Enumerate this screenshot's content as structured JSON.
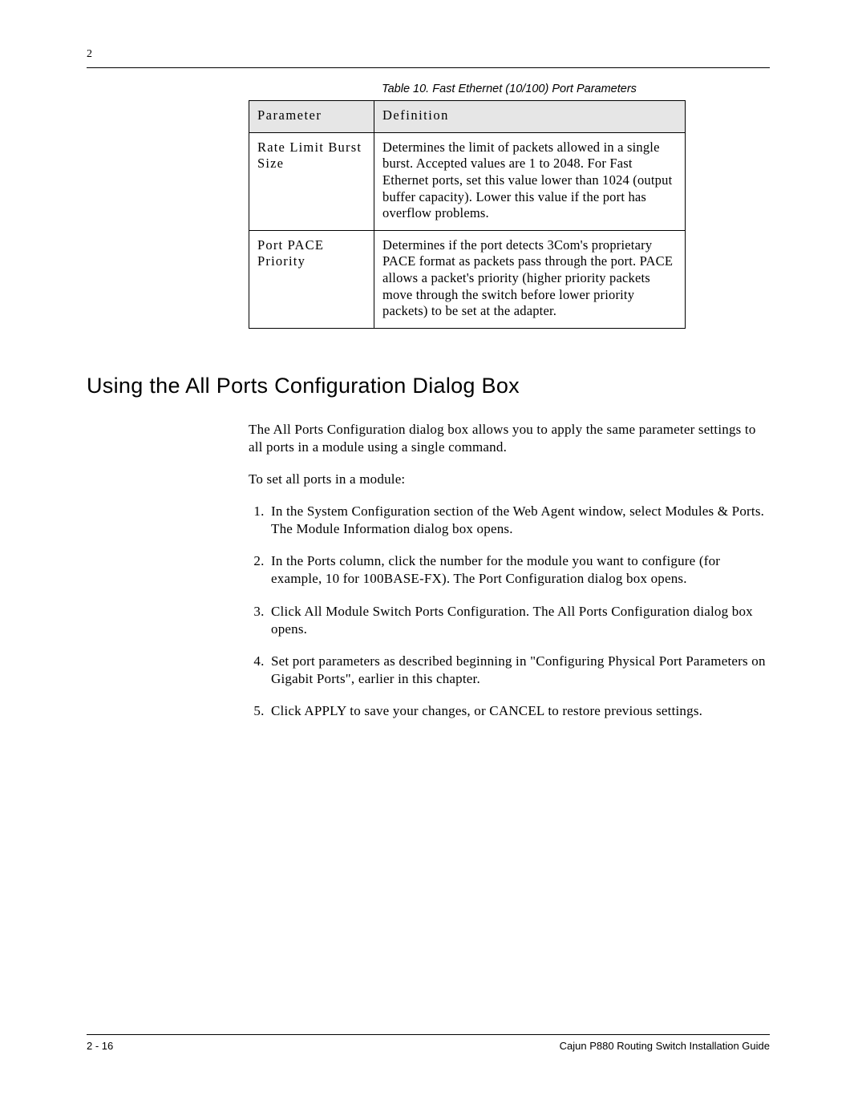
{
  "header": {
    "chapter_number": "2"
  },
  "table": {
    "caption": "Table 10.  Fast Ethernet (10/100) Port Parameters",
    "headers": {
      "param": "Parameter",
      "def": "Definition"
    },
    "rows": [
      {
        "param": "Rate Limit Burst Size",
        "def": "Determines the limit of packets allowed in a single burst. Accepted values are 1 to 2048. For Fast Ethernet ports, set this value lower than 1024 (output buffer capacity). Lower this value if the port has overflow problems."
      },
      {
        "param": "Port PACE Priority",
        "def": "Determines if the port detects 3Com's proprietary PACE format as packets pass through the port. PACE allows a packet's priority (higher priority packets move through the switch before lower priority packets) to be set at the adapter."
      }
    ]
  },
  "section": {
    "heading": "Using the All Ports Configuration Dialog Box",
    "intro": "The All Ports Configuration dialog box allows you to apply the same parameter settings to all ports in a module using a single command.",
    "lead_in": "To set all ports in a module:",
    "steps": [
      "In the System Configuration section of the Web Agent window, select Modules & Ports. The Module Information dialog box opens.",
      "In the Ports column, click the number for the module you want to configure (for example, 10 for 100BASE-FX). The Port Configuration dialog box opens.",
      "Click All Module Switch Ports Configuration. The All Ports Configuration dialog box opens.",
      "Set port parameters as described beginning in \"Configuring Physical Port Parameters on Gigabit Ports\", earlier in this chapter.",
      "Click APPLY to save your changes, or CANCEL to restore previous settings."
    ]
  },
  "footer": {
    "page_number": "2 - 16",
    "doc_title": "Cajun P880 Routing Switch Installation Guide"
  }
}
